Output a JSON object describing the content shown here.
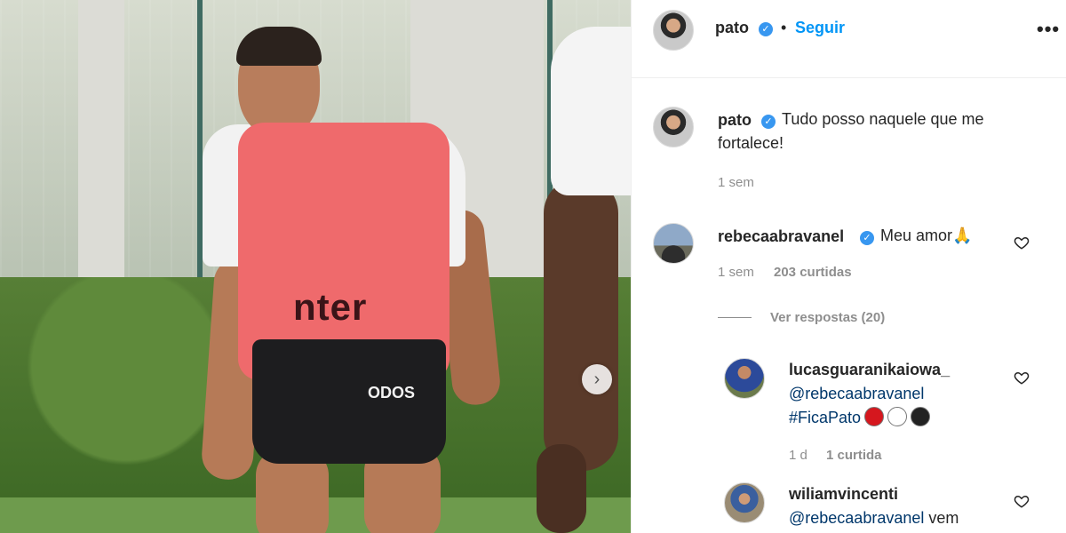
{
  "post": {
    "author": "pato",
    "follow_label": "Seguir",
    "more_label": "•••",
    "separator": "•",
    "caption": {
      "username": "pato",
      "text_line1": "Tudo posso naquele que me",
      "text_line2": "fortalece!",
      "time": "1 sem"
    },
    "photo": {
      "bib_text": "nter",
      "shorts_text": "ODOS",
      "next_label": "›"
    }
  },
  "comments": [
    {
      "username": "rebecaabravanel",
      "text": "Meu amor🙏",
      "time": "1 sem",
      "likes": "203 curtidas",
      "view_replies": "Ver respostas (20)"
    }
  ],
  "replies": [
    {
      "username": "lucasguaranikaiowa_",
      "mention": "@rebecaabravanel",
      "hashtag": "#FicaPato",
      "dot_colors": [
        "#d5171e",
        "#ffffff",
        "#222222"
      ],
      "time": "1 d",
      "likes": "1 curtida"
    },
    {
      "username": "wiliamvincenti",
      "mention": "@rebecaabravanel",
      "text": "vem"
    }
  ],
  "colors": {
    "accent": "#0095f6",
    "verified": "#3897f0",
    "muted": "#8e8e8e"
  }
}
